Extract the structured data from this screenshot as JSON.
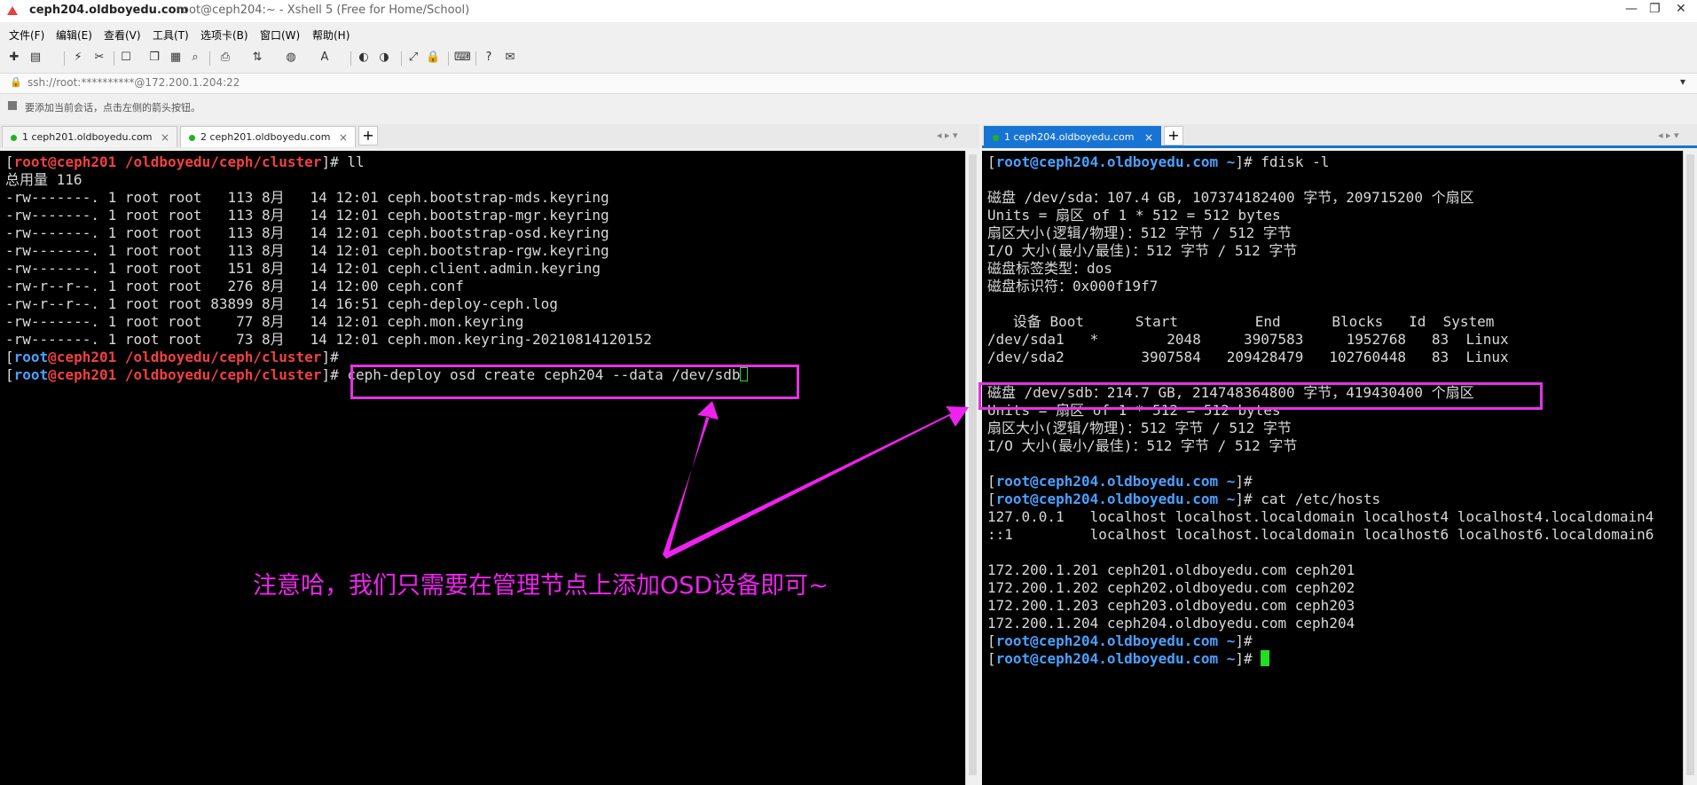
{
  "window": {
    "title": "ceph204.oldboyedu.com",
    "subtitle": "root@ceph204:~ - Xshell 5 (Free for Home/School)",
    "controls": {
      "minimize": "—",
      "restore": "❐",
      "close": "✕"
    }
  },
  "menu": [
    "文件(F)",
    "编辑(E)",
    "查看(V)",
    "工具(T)",
    "选项卡(B)",
    "窗口(W)",
    "帮助(H)"
  ],
  "address": {
    "value": "ssh://root:**********@172.200.1.204:22",
    "dropdown": "▾"
  },
  "hint": "要添加当前会话，点击左侧的箭头按钮。",
  "left_tabs": [
    {
      "label": "1 ceph201.oldboyedu.com",
      "close": "×"
    },
    {
      "label": "2 ceph201.oldboyedu.com",
      "close": "×"
    }
  ],
  "right_tabs": [
    {
      "label": "1 ceph204.oldboyedu.com",
      "close": "×"
    }
  ],
  "tab_add": "+",
  "nav_arrows": "◂ ▸ ▾",
  "left_terminal": {
    "host": "ceph201",
    "dir": "/oldboyedu/ceph/cluster",
    "cmd1": "ll",
    "total": "总用量 116",
    "listing": [
      "-rw-------. 1 root root   113 8月   14 12:01 ceph.bootstrap-mds.keyring",
      "-rw-------. 1 root root   113 8月   14 12:01 ceph.bootstrap-mgr.keyring",
      "-rw-------. 1 root root   113 8月   14 12:01 ceph.bootstrap-osd.keyring",
      "-rw-------. 1 root root   113 8月   14 12:01 ceph.bootstrap-rgw.keyring",
      "-rw-------. 1 root root   151 8月   14 12:01 ceph.client.admin.keyring",
      "-rw-r--r--. 1 root root   276 8月   14 12:00 ceph.conf",
      "-rw-r--r--. 1 root root 83899 8月   14 16:51 ceph-deploy-ceph.log",
      "-rw-------. 1 root root    77 8月   14 12:01 ceph.mon.keyring",
      "-rw-------. 1 root root    73 8月   14 12:01 ceph.mon.keyring-20210814120152"
    ],
    "cmd3": "ceph-deploy osd create ceph204 --data /dev/sdb"
  },
  "right_terminal": {
    "host": "ceph204.oldboyedu.com",
    "dir": "~",
    "cmd1": "fdisk -l",
    "fdisk_a": [
      "磁盘 /dev/sda：107.4 GB, 107374182400 字节，209715200 个扇区",
      "Units = 扇区 of 1 * 512 = 512 bytes",
      "扇区大小(逻辑/物理)：512 字节 / 512 字节",
      "I/O 大小(最小/最佳)：512 字节 / 512 字节",
      "磁盘标签类型：dos",
      "磁盘标识符：0x000f19f7",
      "",
      "   设备 Boot      Start         End      Blocks   Id  System",
      "/dev/sda1   *        2048     3907583     1952768   83  Linux",
      "/dev/sda2         3907584   209428479   102760448   83  Linux",
      ""
    ],
    "sdb_line": "磁盘 /dev/sdb：214.7 GB, 214748364800 字节，419430400 个扇区",
    "fdisk_b": [
      "Units = 扇区 of 1 * 512 = 512 bytes",
      "扇区大小(逻辑/物理)：512 字节 / 512 字节",
      "I/O 大小(最小/最佳)：512 字节 / 512 字节",
      ""
    ],
    "cmd3": "cat /etc/hosts",
    "hosts": [
      "127.0.0.1   localhost localhost.localdomain localhost4 localhost4.localdomain4",
      "::1         localhost localhost.localdomain localhost6 localhost6.localdomain6",
      "",
      "172.200.1.201 ceph201.oldboyedu.com ceph201",
      "172.200.1.202 ceph202.oldboyedu.com ceph202",
      "172.200.1.203 ceph203.oldboyedu.com ceph203",
      "172.200.1.204 ceph204.oldboyedu.com ceph204"
    ]
  },
  "annotation": "注意哈，我们只需要在管理节点上添加OSD设备即可~",
  "colors": {
    "annotation": "#ee22ee",
    "prompt_user": "#4aa0ff",
    "prompt_host": "#f04040",
    "cursor": "#22dd22",
    "tab_active": "#1874d4"
  }
}
